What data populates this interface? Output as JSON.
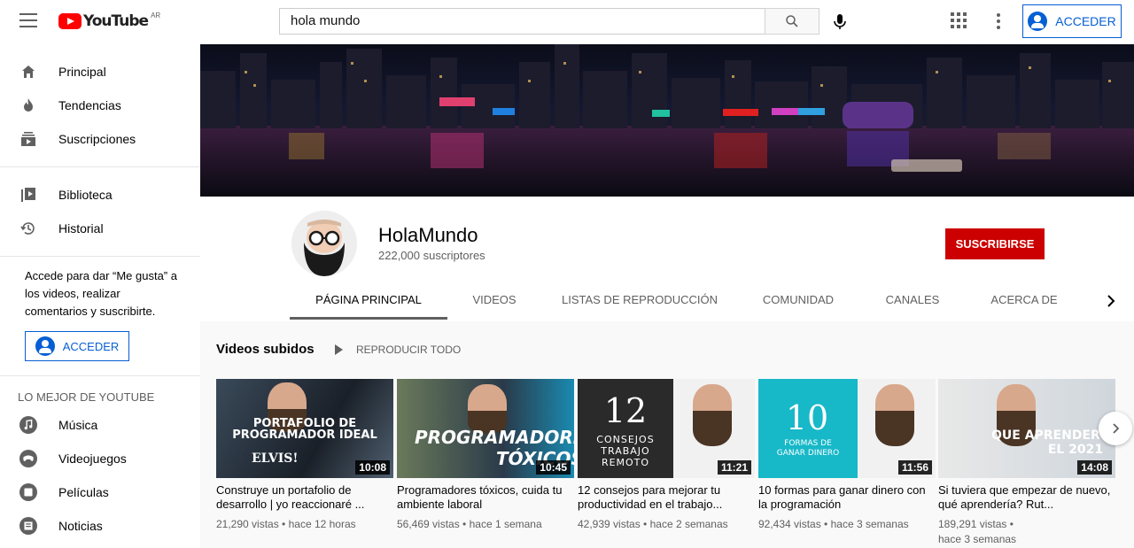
{
  "header": {
    "logo_text": "YouTube",
    "region": "AR",
    "search_value": "hola mundo",
    "signin_label": "ACCEDER"
  },
  "sidebar": {
    "items": [
      {
        "label": "Principal",
        "icon": "home-icon"
      },
      {
        "label": "Tendencias",
        "icon": "flame-icon"
      },
      {
        "label": "Suscripciones",
        "icon": "subscriptions-icon"
      }
    ],
    "items2": [
      {
        "label": "Biblioteca",
        "icon": "library-icon"
      },
      {
        "label": "Historial",
        "icon": "history-icon"
      }
    ],
    "signin_prompt": "Accede para dar “Me gusta” a los videos, realizar comentarios y suscribirte.",
    "signin_label": "ACCEDER",
    "best_heading": "LO MEJOR DE YOUTUBE",
    "best_items": [
      {
        "label": "Música",
        "icon": "music-icon"
      },
      {
        "label": "Videojuegos",
        "icon": "gaming-icon"
      },
      {
        "label": "Películas",
        "icon": "movies-icon"
      },
      {
        "label": "Noticias",
        "icon": "news-icon"
      }
    ]
  },
  "channel": {
    "name": "HolaMundo",
    "subscribers": "222,000 suscriptores",
    "subscribe_label": "SUSCRIBIRSE",
    "tabs": [
      "PÁGINA PRINCIPAL",
      "VIDEOS",
      "LISTAS DE REPRODUCCIÓN",
      "COMUNIDAD",
      "CANALES",
      "ACERCA DE"
    ],
    "active_tab": "PÁGINA PRINCIPAL"
  },
  "section": {
    "title": "Videos subidos",
    "play_all": "REPRODUCIR TODO"
  },
  "videos": [
    {
      "title": "Construye un portafolio de desarrollo | yo reaccionaré ...",
      "views": "21,290 vistas",
      "age": "hace 12 horas",
      "duration": "10:08",
      "thumb_text": "PORTAFOLIO DE PROGRAMADOR IDEAL",
      "thumb_text2": "ELVIS!"
    },
    {
      "title": "Programadores tóxicos, cuida tu ambiente laboral",
      "views": "56,469 vistas",
      "age": "hace 1 semana",
      "duration": "10:45",
      "thumb_text": "PROGRAMADORES",
      "thumb_text2": "TÓXICOS"
    },
    {
      "title": "12 consejos para mejorar tu productividad en el trabajo...",
      "views": "42,939 vistas",
      "age": "hace 2 semanas",
      "duration": "11:21",
      "thumb_text": "12",
      "thumb_text2": "CONSEJOS TRABAJO REMOTO"
    },
    {
      "title": "10 formas para ganar dinero con la programación",
      "views": "92,434 vistas",
      "age": "hace 3 semanas",
      "duration": "11:56",
      "thumb_text": "10",
      "thumb_text2": "FORMAS DE GANAR DINERO"
    },
    {
      "title": "Si tuviera que empezar de nuevo, qué aprendería? Rut...",
      "views": "189,291 vistas",
      "age": "hace 3 semanas",
      "duration": "14:08",
      "thumb_text": "QUE APRENDER",
      "thumb_text2": "EL 2021"
    }
  ],
  "colors": {
    "brand_red": "#ff0000",
    "subscribe_red": "#cc0000",
    "link_blue": "#065fd4"
  }
}
